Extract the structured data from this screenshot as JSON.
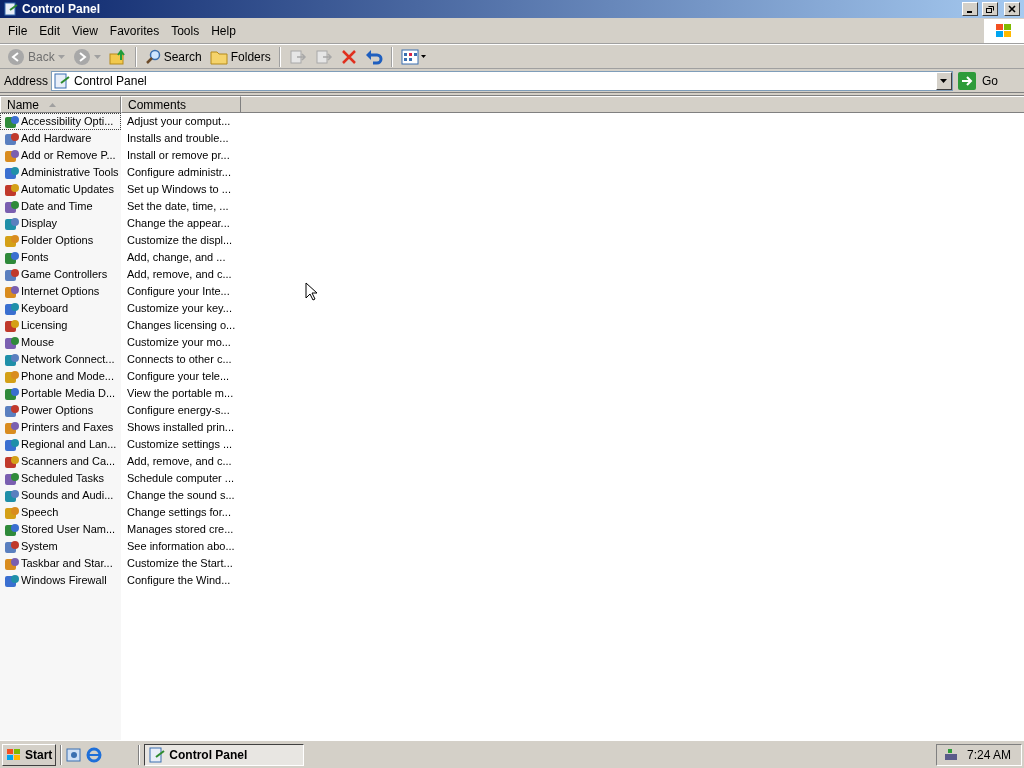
{
  "window": {
    "title": "Control Panel"
  },
  "menu": [
    "File",
    "Edit",
    "View",
    "Favorites",
    "Tools",
    "Help"
  ],
  "toolbar": [
    {
      "kind": "nav",
      "label": "Back",
      "disabled": true
    },
    {
      "kind": "navicon",
      "disabled": true
    },
    {
      "kind": "up",
      "disabled": false
    },
    {
      "kind": "sep"
    },
    {
      "kind": "search",
      "label": "Search",
      "disabled": false
    },
    {
      "kind": "folders",
      "label": "Folders",
      "disabled": false
    },
    {
      "kind": "sep"
    },
    {
      "kind": "moveto",
      "disabled": true
    },
    {
      "kind": "copyto",
      "disabled": true
    },
    {
      "kind": "delete",
      "disabled": false
    },
    {
      "kind": "undo",
      "disabled": false
    },
    {
      "kind": "sep"
    },
    {
      "kind": "views",
      "disabled": false
    }
  ],
  "address": {
    "label": "Address",
    "value": "Control Panel",
    "go": "Go"
  },
  "table": {
    "columns": [
      {
        "label": "Name",
        "sorted": true
      },
      {
        "label": "Comments",
        "sorted": false
      }
    ],
    "rows": [
      {
        "name": "Accessibility Opti...",
        "comment": "Adjust your comput...",
        "focused": true
      },
      {
        "name": "Add Hardware",
        "comment": "Installs and trouble...",
        "focused": false
      },
      {
        "name": "Add or Remove P...",
        "comment": "Install or remove pr...",
        "focused": false
      },
      {
        "name": "Administrative Tools",
        "comment": "Configure administr...",
        "focused": false
      },
      {
        "name": "Automatic Updates",
        "comment": "Set up Windows to ...",
        "focused": false
      },
      {
        "name": "Date and Time",
        "comment": "Set the date, time, ...",
        "focused": false
      },
      {
        "name": "Display",
        "comment": "Change the appear...",
        "focused": false
      },
      {
        "name": "Folder Options",
        "comment": "Customize the displ...",
        "focused": false
      },
      {
        "name": "Fonts",
        "comment": "Add, change, and ...",
        "focused": false
      },
      {
        "name": "Game Controllers",
        "comment": "Add, remove, and c...",
        "focused": false
      },
      {
        "name": "Internet Options",
        "comment": "Configure your Inte...",
        "focused": false
      },
      {
        "name": "Keyboard",
        "comment": "Customize your key...",
        "focused": false
      },
      {
        "name": "Licensing",
        "comment": "Changes licensing o...",
        "focused": false
      },
      {
        "name": "Mouse",
        "comment": "Customize your mo...",
        "focused": false
      },
      {
        "name": "Network Connect...",
        "comment": "Connects to other c...",
        "focused": false
      },
      {
        "name": "Phone and Mode...",
        "comment": "Configure your tele...",
        "focused": false
      },
      {
        "name": "Portable Media D...",
        "comment": "View the portable m...",
        "focused": false
      },
      {
        "name": "Power Options",
        "comment": "Configure energy-s...",
        "focused": false
      },
      {
        "name": "Printers and Faxes",
        "comment": "Shows installed prin...",
        "focused": false
      },
      {
        "name": "Regional and Lan...",
        "comment": "Customize settings ...",
        "focused": false
      },
      {
        "name": "Scanners and Ca...",
        "comment": "Add, remove, and c...",
        "focused": false
      },
      {
        "name": "Scheduled Tasks",
        "comment": "Schedule computer ...",
        "focused": false
      },
      {
        "name": "Sounds and Audi...",
        "comment": "Change the sound s...",
        "focused": false
      },
      {
        "name": "Speech",
        "comment": "Change settings for...",
        "focused": false
      },
      {
        "name": "Stored User Nam...",
        "comment": "Manages stored cre...",
        "focused": false
      },
      {
        "name": "System",
        "comment": "See information abo...",
        "focused": false
      },
      {
        "name": "Taskbar and Star...",
        "comment": "Customize the Start...",
        "focused": false
      },
      {
        "name": "Windows Firewall",
        "comment": "Configure the Wind...",
        "focused": false
      }
    ]
  },
  "taskbar": {
    "start": "Start",
    "tasks": [
      {
        "label": "Control Panel",
        "selected": true
      }
    ],
    "clock": "7:24 AM"
  }
}
